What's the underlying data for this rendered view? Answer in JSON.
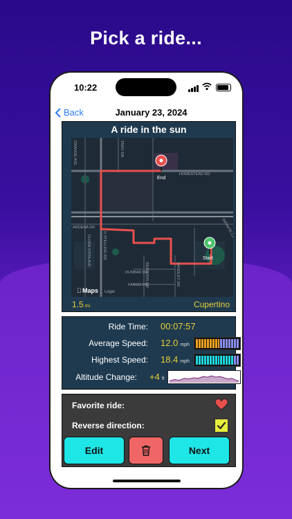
{
  "headline": "Pick a ride...",
  "status": {
    "time": "10:22"
  },
  "nav": {
    "back_label": "Back",
    "title": "January 23, 2024"
  },
  "map": {
    "title": "A ride in the sun",
    "distance": "1.5",
    "distance_unit": "mi",
    "city": "Cupertino",
    "end_label": "End",
    "start_label": "Start",
    "attribution": "Maps",
    "legal": "Legal",
    "streets": [
      "HOMESTEAD RD",
      "N STELLING RD",
      "DUNBAR DR",
      "FARGO DR",
      "ARDENA DR",
      "FLORA VISTA AVE",
      "BEARDON DR",
      "BANDLEY DR",
      "INFINITE LOOP",
      "TARO DR",
      "ORANGE AVE"
    ],
    "route_color": "#e8504f",
    "end_pin_color": "#e8504f",
    "start_pin_color": "#4cc46a"
  },
  "stats": {
    "ride_time_label": "Ride Time:",
    "ride_time": "00:07:57",
    "avg_speed_label": "Average Speed:",
    "avg_speed": "12.0",
    "avg_fill": 0.55,
    "highest_speed_label": "Highest Speed:",
    "highest_speed": "18.4",
    "highest_fill": 0.82,
    "speed_unit": "mph",
    "altitude_label": "Altitude Change:",
    "altitude": "+4",
    "altitude_unit": "ft",
    "value_color": "#e7cf37"
  },
  "controls": {
    "favorite_label": "Favorite ride:",
    "reverse_label": "Reverse direction:",
    "edit_label": "Edit",
    "next_label": "Next"
  }
}
